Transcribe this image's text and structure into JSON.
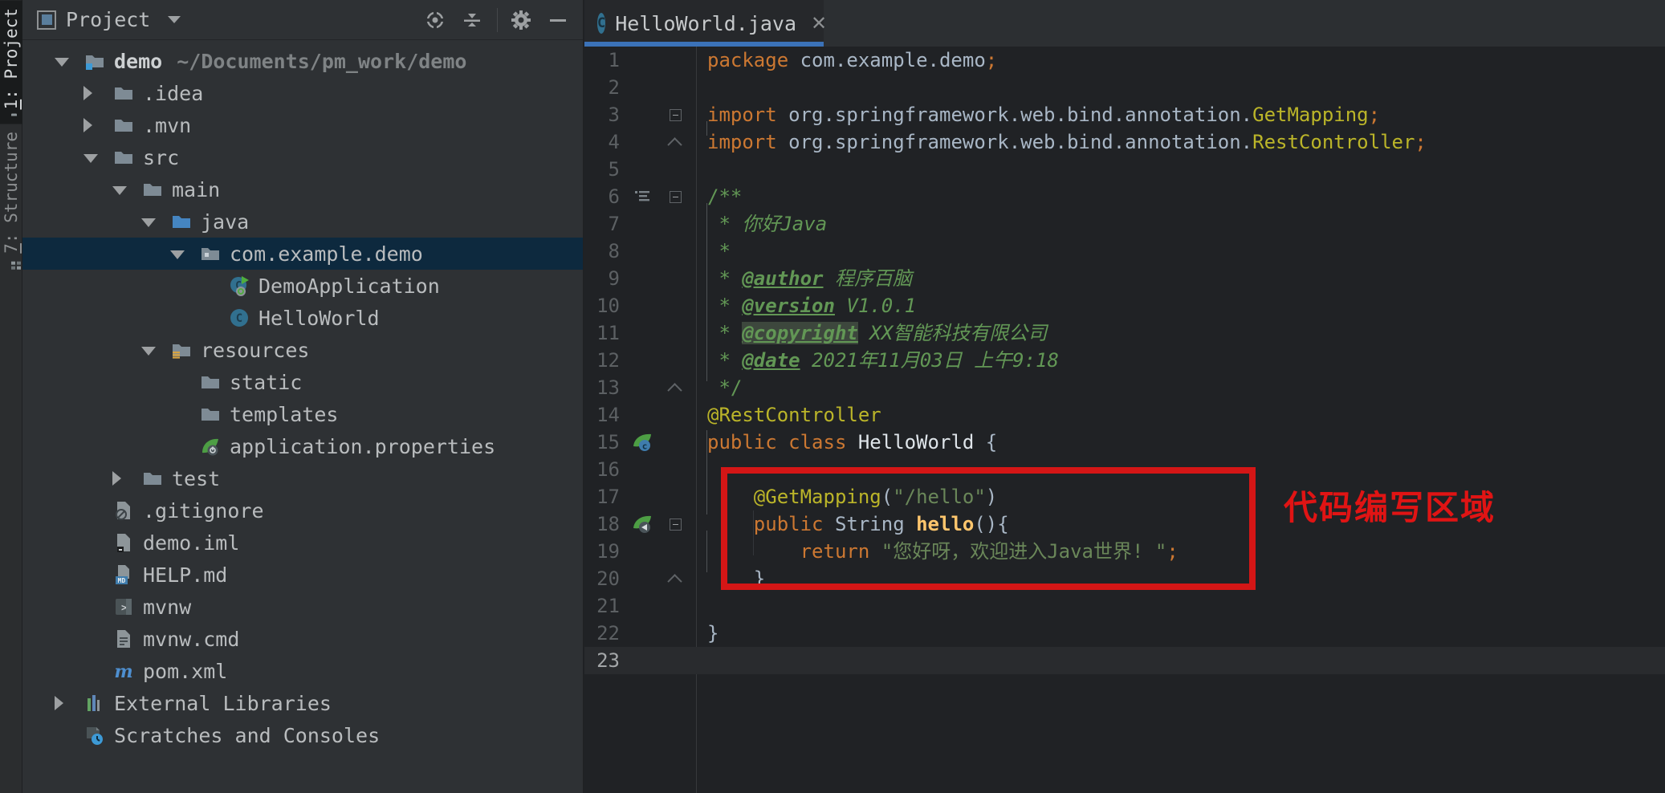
{
  "tool_window_bar": {
    "buttons": [
      {
        "mnemonic": "1",
        "label": "Project",
        "icon": "project-folder-icon",
        "active": true
      },
      {
        "mnemonic": "7",
        "label": "Structure",
        "icon": "structure-icon",
        "active": false
      }
    ]
  },
  "project_panel": {
    "toolbar": {
      "selector_label": "Project",
      "icons": [
        "locate-icon",
        "collapse-all-icon",
        "settings-gear-icon",
        "hide-panel-icon"
      ]
    },
    "tree": [
      {
        "label": "demo",
        "hint": "~/Documents/pm_work/demo",
        "icon": "folder-root",
        "arrow": "open",
        "level": 0,
        "selected": false,
        "root": true
      },
      {
        "label": ".idea",
        "icon": "folder",
        "arrow": "closed",
        "level": 1,
        "selected": false
      },
      {
        "label": ".mvn",
        "icon": "folder",
        "arrow": "closed",
        "level": 1,
        "selected": false
      },
      {
        "label": "src",
        "icon": "folder",
        "arrow": "open",
        "level": 1,
        "selected": false
      },
      {
        "label": "main",
        "icon": "folder",
        "arrow": "open",
        "level": 2,
        "selected": false
      },
      {
        "label": "java",
        "icon": "folder-java",
        "arrow": "open",
        "level": 3,
        "selected": false
      },
      {
        "label": "com.example.demo",
        "icon": "folder-package",
        "arrow": "open",
        "level": 4,
        "selected": true
      },
      {
        "label": "DemoApplication",
        "icon": "boot-class",
        "arrow": null,
        "level": 5,
        "selected": false
      },
      {
        "label": "HelloWorld",
        "icon": "class-c",
        "arrow": null,
        "level": 5,
        "selected": false
      },
      {
        "label": "resources",
        "icon": "folder-resources",
        "arrow": "open",
        "level": 3,
        "selected": false
      },
      {
        "label": "static",
        "icon": "folder",
        "arrow": null,
        "level": 4,
        "selected": false
      },
      {
        "label": "templates",
        "icon": "folder",
        "arrow": null,
        "level": 4,
        "selected": false
      },
      {
        "label": "application.properties",
        "icon": "spring-config",
        "arrow": null,
        "level": 4,
        "selected": false
      },
      {
        "label": "test",
        "icon": "folder",
        "arrow": "closed",
        "level": 2,
        "selected": false
      },
      {
        "label": ".gitignore",
        "icon": "git-file",
        "arrow": null,
        "level": 1,
        "selected": false
      },
      {
        "label": "demo.iml",
        "icon": "iml-file",
        "arrow": null,
        "level": 1,
        "selected": false
      },
      {
        "label": "HELP.md",
        "icon": "md-file",
        "arrow": null,
        "level": 1,
        "selected": false
      },
      {
        "label": "mvnw",
        "icon": "script-file",
        "arrow": null,
        "level": 1,
        "selected": false
      },
      {
        "label": "mvnw.cmd",
        "icon": "text-file",
        "arrow": null,
        "level": 1,
        "selected": false
      },
      {
        "label": "pom.xml",
        "icon": "maven-file",
        "arrow": null,
        "level": 1,
        "selected": false
      },
      {
        "label": "External Libraries",
        "icon": "ext-lib",
        "arrow": "closed",
        "level": 0,
        "selected": false
      },
      {
        "label": "Scratches and Consoles",
        "icon": "scratches",
        "arrow": null,
        "level": 0,
        "selected": false
      }
    ]
  },
  "editor": {
    "tab": {
      "label": "HelloWorld.java",
      "icon": "class-c-icon",
      "close_glyph": "✕"
    },
    "lines": [
      {
        "num": 1,
        "fold": null,
        "gicon": null,
        "tokens": [
          [
            "kw",
            "package "
          ],
          [
            "pl",
            "com.example.demo"
          ],
          [
            "kw",
            ";"
          ]
        ]
      },
      {
        "num": 2,
        "fold": null,
        "gicon": null,
        "tokens": []
      },
      {
        "num": 3,
        "fold": "start",
        "gicon": null,
        "tokens": [
          [
            "kw",
            "import "
          ],
          [
            "pl",
            "org.springframework.web.bind.annotation."
          ],
          [
            "an",
            "GetMapping"
          ],
          [
            "kw",
            ";"
          ]
        ]
      },
      {
        "num": 4,
        "fold": "end",
        "gicon": null,
        "tokens": [
          [
            "kw",
            "import "
          ],
          [
            "pl",
            "org.springframework.web.bind.annotation."
          ],
          [
            "an",
            "RestController"
          ],
          [
            "kw",
            ";"
          ]
        ]
      },
      {
        "num": 5,
        "fold": null,
        "gicon": null,
        "tokens": []
      },
      {
        "num": 6,
        "fold": "start",
        "gicon": "doc-lines-icon",
        "tokens": [
          [
            "dc",
            "/**"
          ]
        ]
      },
      {
        "num": 7,
        "fold": null,
        "gicon": null,
        "tokens": [
          [
            "dc",
            " * "
          ],
          [
            "di",
            "你好Java"
          ]
        ]
      },
      {
        "num": 8,
        "fold": null,
        "gicon": null,
        "tokens": [
          [
            "dc",
            " *"
          ]
        ]
      },
      {
        "num": 9,
        "fold": null,
        "gicon": null,
        "tokens": [
          [
            "dc",
            " * "
          ],
          [
            "dt",
            "@author"
          ],
          [
            "di",
            " 程序百脑"
          ]
        ]
      },
      {
        "num": 10,
        "fold": null,
        "gicon": null,
        "tokens": [
          [
            "dc",
            " * "
          ],
          [
            "dt",
            "@version"
          ],
          [
            "di",
            " V1.0.1"
          ]
        ]
      },
      {
        "num": 11,
        "fold": null,
        "gicon": null,
        "tokens": [
          [
            "dc",
            " * "
          ],
          [
            "dth",
            "@copyright"
          ],
          [
            "di",
            " XX智能科技有限公司"
          ]
        ]
      },
      {
        "num": 12,
        "fold": null,
        "gicon": null,
        "tokens": [
          [
            "dc",
            " * "
          ],
          [
            "dt",
            "@date"
          ],
          [
            "di",
            " 2021年11月03日 上午9:18"
          ]
        ]
      },
      {
        "num": 13,
        "fold": "end",
        "gicon": null,
        "tokens": [
          [
            "dc",
            " */"
          ]
        ]
      },
      {
        "num": 14,
        "fold": null,
        "gicon": null,
        "tokens": [
          [
            "an",
            "@RestController"
          ]
        ]
      },
      {
        "num": 15,
        "fold": null,
        "gicon": "spring-bean-icon",
        "tokens": [
          [
            "kw",
            "public class "
          ],
          [
            "cn",
            "HelloWorld "
          ],
          [
            "pl",
            "{"
          ]
        ]
      },
      {
        "num": 16,
        "fold": null,
        "gicon": null,
        "tokens": []
      },
      {
        "num": 17,
        "fold": null,
        "gicon": null,
        "tokens": [
          [
            "pl",
            "    "
          ],
          [
            "an",
            "@GetMapping"
          ],
          [
            "pl",
            "("
          ],
          [
            "st",
            "\"/hello\""
          ],
          [
            "pl",
            ")"
          ]
        ]
      },
      {
        "num": 18,
        "fold": "start",
        "gicon": "spring-mapping-icon",
        "tokens": [
          [
            "pl",
            "    "
          ],
          [
            "kw",
            "public "
          ],
          [
            "pl",
            "String "
          ],
          [
            "mt",
            "hello"
          ],
          [
            "pl",
            "(){"
          ]
        ]
      },
      {
        "num": 19,
        "fold": null,
        "gicon": null,
        "tokens": [
          [
            "pl",
            "        "
          ],
          [
            "kw",
            "return "
          ],
          [
            "st",
            "\"您好呀，欢迎进入Java世界! \""
          ],
          [
            "kw",
            ";"
          ]
        ]
      },
      {
        "num": 20,
        "fold": "end",
        "gicon": null,
        "tokens": [
          [
            "pl",
            "    }"
          ]
        ]
      },
      {
        "num": 21,
        "fold": null,
        "gicon": null,
        "tokens": []
      },
      {
        "num": 22,
        "fold": null,
        "gicon": null,
        "tokens": [
          [
            "pl",
            "}"
          ]
        ]
      },
      {
        "num": 23,
        "fold": null,
        "gicon": null,
        "tokens": [],
        "caret": true
      }
    ],
    "annotation": {
      "label": "代码编写区域",
      "box_first_line": 17,
      "box_last_line": 20,
      "color": "#d41616"
    }
  },
  "colors": {
    "editor_bg": "#202225",
    "panel_bg": "#2e3134",
    "selection_bg": "#0d293e",
    "tab_underline": "#3b72b8",
    "keyword": "#cc7832",
    "annotation": "#bbb529",
    "string": "#6a8759",
    "doc_comment": "#629755",
    "method": "#ffc66d",
    "line_number": "#5c6063",
    "red_annotation": "#d41616"
  }
}
